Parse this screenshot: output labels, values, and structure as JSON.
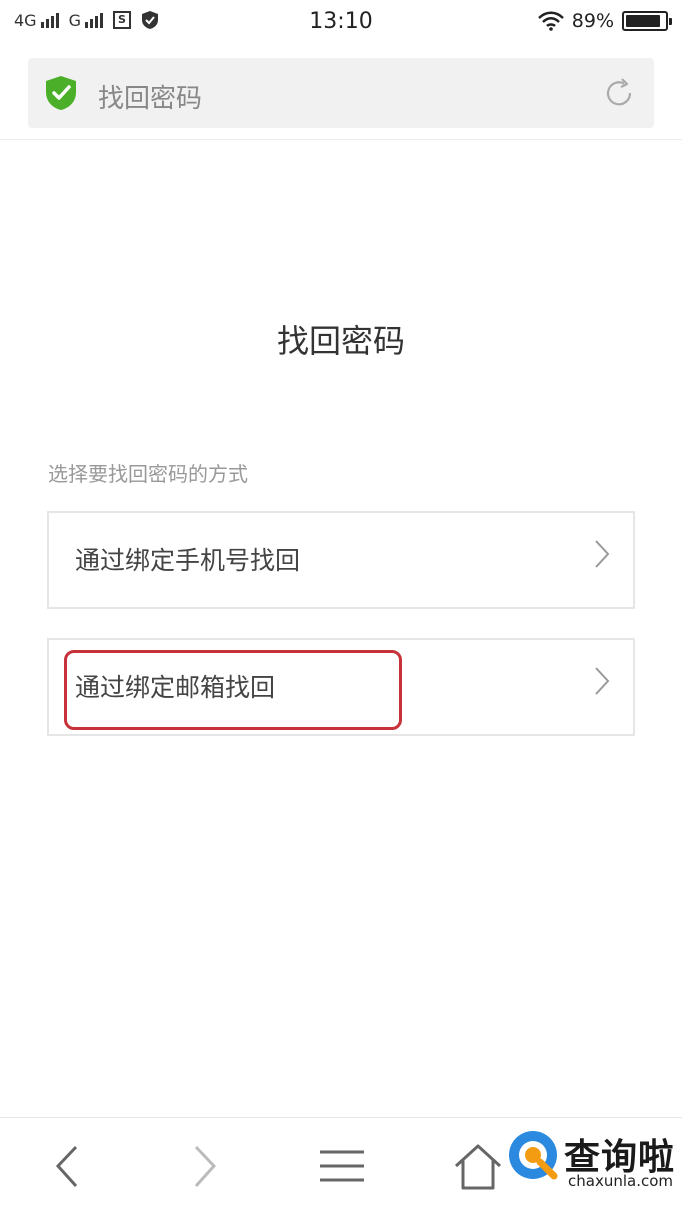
{
  "status_bar": {
    "network1": "4G",
    "network2": "G",
    "time": "13:10",
    "battery": "89%",
    "battery_level": 0.89
  },
  "address_bar": {
    "title": "找回密码",
    "security_icon": "shield-check-icon",
    "refresh_icon": "refresh-icon",
    "accent": "#4caf2a"
  },
  "main": {
    "title": "找回密码",
    "section_label": "选择要找回密码的方式",
    "options": [
      {
        "label": "通过绑定手机号找回",
        "icon": "chevron-right-icon"
      },
      {
        "label": "通过绑定邮箱找回",
        "icon": "chevron-right-icon",
        "highlighted": true
      }
    ],
    "highlight_color": "#c8323b"
  },
  "bottom_nav": {
    "items": [
      "back-icon",
      "forward-icon",
      "menu-icon",
      "home-icon"
    ]
  },
  "watermark": {
    "text": "查询啦",
    "domain": "chaxunla.com"
  }
}
